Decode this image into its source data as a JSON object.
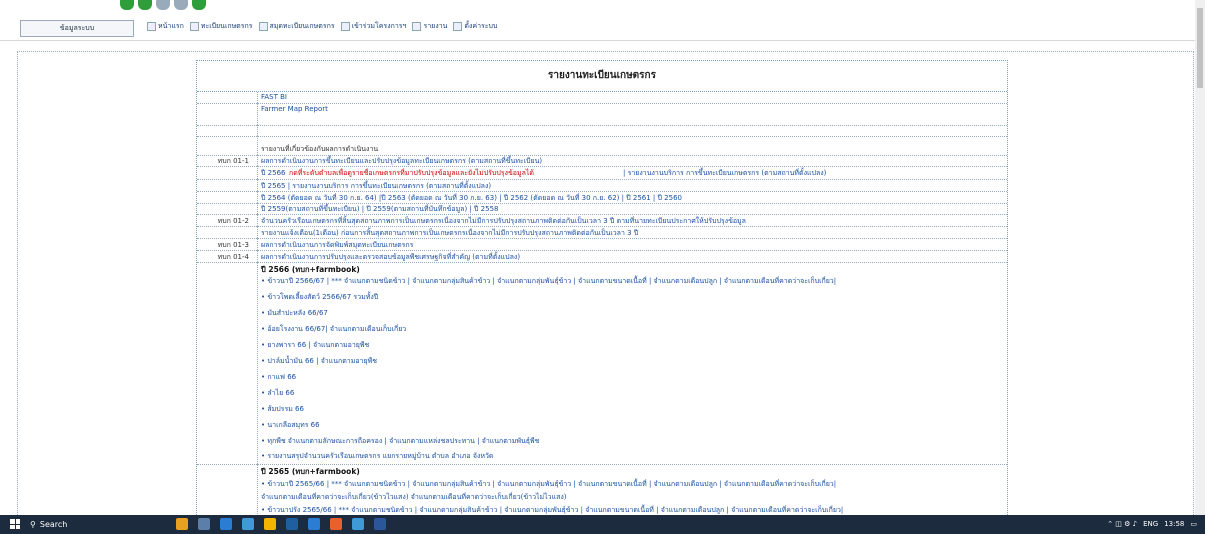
{
  "topbar": {
    "system_button": "ข้อมูลระบบ",
    "menu": [
      "หน้าแรก",
      "ทะเบียนเกษตรกร",
      "สมุดทะเบียนเกษตรกร",
      "เข้าร่วมโครงการฯ",
      "รายงาน",
      "ตั้งค่าระบบ"
    ]
  },
  "report": {
    "title": "รายงานทะเบียนเกษตรกร",
    "fast_bi": "FAST BI",
    "farmer_map": "Farmer Map Report",
    "section_ops": "รายงานที่เกี่ยวข้องกับผลการดำเนินงาน",
    "r1_code": "ทบก 01-1",
    "r1_text": "ผลการดำเนินงานการขึ้นทะเบียนและปรับปรุงข้อมูลทะเบียนเกษตรกร (ตามสถานที่ขึ้นทะเบียน)",
    "r1_l1_a": "ปี 2566",
    "r1_l1_red": "กดที่ระดับตำบลเพื่อดูรายชื่อเกษตรกรที่มาปรับปรุงข้อมูลและยังไม่ปรับปรุงข้อมูลได้",
    "r1_l1_b": "| รายงานงานบริการ การขึ้นทะเบียนเกษตรกร (ตามสถานที่ตั้งแปลง)",
    "r1_l2": "ปี 2565 | รายงานงานบริการ การขึ้นทะเบียนเกษตรกร (ตามสถานที่ตั้งแปลง)",
    "r1_l3": "ปี 2564 (ตัดยอด ณ วันที่ 30 ก.ย. 64) |ปี 2563 (ตัดยอด ณ วันที่ 30 ก.ย. 63) | ปี 2562 (ตัดยอด ณ วันที่ 30 ก.ย. 62) | ปี 2561 | ปี 2560",
    "r1_l4": "ปี 2559(ตามสถานที่ขึ้นทะเบียน) | ปี 2559(ตามสถานที่บันทึกข้อมูล) | ปี 2558",
    "r2_code": "ทบก 01-2",
    "r2_text": "จำนวนครัวเรือนเกษตรกรที่สิ้นสุดสถานภาพการเป็นเกษตรกรเนื่องจากไม่มีการปรับปรุงสถานภาพติดต่อกันเป็นเวลา 3 ปี ตามที่นายทะเบียนประกาศให้ปรับปรุงข้อมูล",
    "r2_l2": "รายงานแจ้งเตือน(1เดือน) ก่อนการสิ้นสุดสถานภาพการเป็นเกษตรกรเนื่องจากไม่มีการปรับปรุงสถานภาพติดต่อกันเป็นเวลา 3 ปี",
    "r3_code": "ทบก 01-3",
    "r3_text": "ผลการดำเนินงานการจัดพิมพ์สมุดทะเบียนเกษตรกร",
    "r4_code": "ทบก 01-4",
    "r4_text": "ผลการดำเนินงานการปรับปรุงและตรวจสอบข้อมูลพืชเศรษฐกิจที่สำคัญ (ตามที่ตั้งแปลง)",
    "y66_head": "ปี 2566 (ทบก+farmbook)",
    "y66_items": [
      "• ข้าวนาปี 2566/67 | *** จำแนกตามชนิดข้าว | จำแนกตามกลุ่มสินค้าข้าว | จำแนกตามกลุ่มพันธุ์ข้าว | จำแนกตามขนาดเนื้อที่ | จำแนกตามเดือนปลูก | จำแนกตามเดือนที่คาดว่าจะเก็บเกี่ยว|",
      "• ข้าวโพดเลี้ยงสัตว์ 2566/67 รวมทั้งปี",
      "• มันสำปะหลัง 66/67",
      "• อ้อยโรงงาน 66/67| จำแนกตามเดือนเก็บเกี่ยว",
      "• ยางพารา 66 | จำแนกตามอายุพืช",
      "• ปาล์มน้ำมัน 66 | จำแนกตามอายุพืช",
      "• กาแฟ 66",
      "• ลำไย 66",
      "• ส้มปรรม 66",
      "• นาเกลือสมุทร 66",
      "• ทุกพืช จำแนกตามลักษณะการถือครอง | จำแนกตามแหล่งชลประทาน | จำแนกตามพันธุ์พืช",
      "• รายงานสรุปจำนวนครัวเรือนเกษตรกร แยกรายหมู่บ้าน ตำบล อำเภอ จังหวัด"
    ],
    "y65_head": "ปี 2565 (ทบก+farmbook)",
    "y65_items": [
      "• ข้าวนาปี 2565/66 | *** จำแนกตามชนิดข้าว | จำแนกตามกลุ่มสินค้าข้าว | จำแนกตามกลุ่มพันธุ์ข้าว | จำแนกตามขนาดเนื้อที่ | จำแนกตามเดือนปลูก | จำแนกตามเดือนที่คาดว่าจะเก็บเกี่ยว|",
      "จำแนกตามเดือนที่คาดว่าจะเก็บเกี่ยว(ข้าวไวแสง) จำแนกตามเดือนที่คาดว่าจะเก็บเกี่ยว(ข้าวไม่ไวแสง)",
      "• ข้าวนาปรัง 2565/66 | *** จำแนกตามชนิดข้าว | จำแนกตามกลุ่มสินค้าข้าว | จำแนกตามกลุ่มพันธุ์ข้าว | จำแนกตามขนาดเนื้อที่ | จำแนกตามเดือนปลูก | จำแนกตามเดือนที่คาดว่าจะเก็บเกี่ยว|"
    ]
  },
  "taskbar": {
    "search": "Search",
    "lang": "ENG",
    "time": "13:58"
  },
  "colors": {
    "link": "#1a4fa0",
    "alert": "#cc0000",
    "taskbar": "#1c2b3d"
  }
}
